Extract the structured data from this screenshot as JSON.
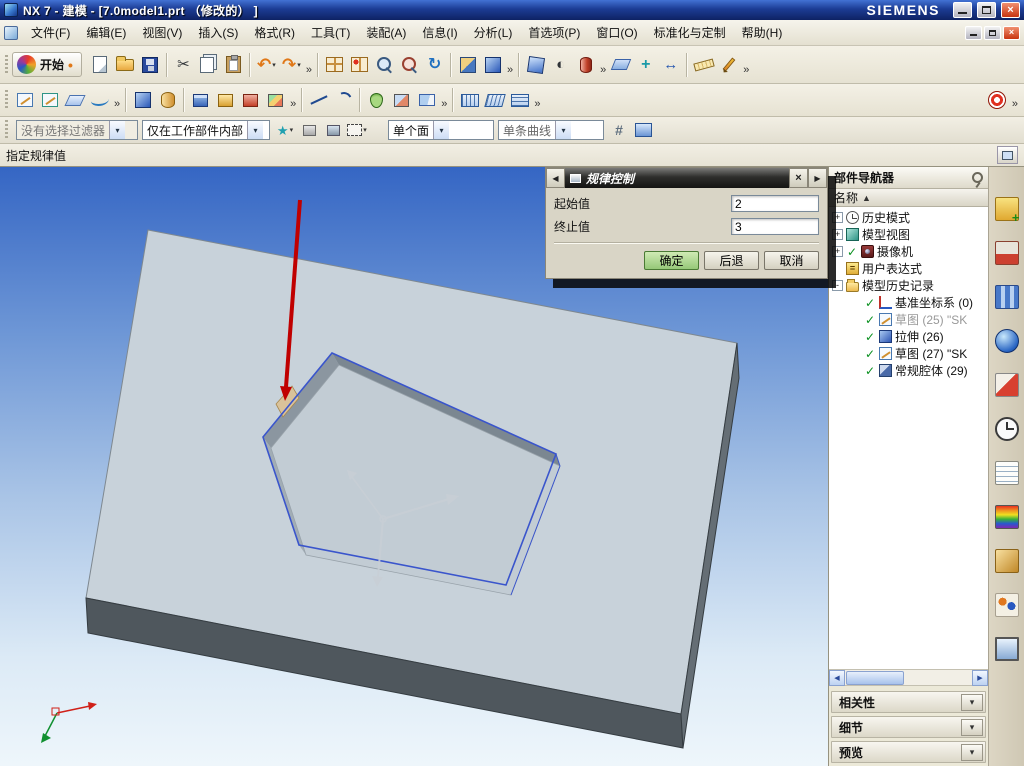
{
  "glyphs": {
    "overflow": "»",
    "dropdown": "▾",
    "check": "✓",
    "sort_asc": "▲",
    "back": "◀",
    "forward": "▶",
    "close": "×",
    "section_chevron": "▾",
    "scroll_left": "◀",
    "scroll_right": "▶",
    "bullet": "•"
  },
  "window": {
    "title": "NX 7 - 建模 - [7.0model1.prt （修改的） ]",
    "brand": "SIEMENS"
  },
  "menubar": {
    "items": [
      {
        "label": "文件(F)",
        "name": "menu-file"
      },
      {
        "label": "编辑(E)",
        "name": "menu-edit"
      },
      {
        "label": "视图(V)",
        "name": "menu-view"
      },
      {
        "label": "插入(S)",
        "name": "menu-insert"
      },
      {
        "label": "格式(R)",
        "name": "menu-format"
      },
      {
        "label": "工具(T)",
        "name": "menu-tools"
      },
      {
        "label": "装配(A)",
        "name": "menu-assemblies"
      },
      {
        "label": "信息(I)",
        "name": "menu-information"
      },
      {
        "label": "分析(L)",
        "name": "menu-analysis"
      },
      {
        "label": "首选项(P)",
        "name": "menu-preferences"
      },
      {
        "label": "窗口(O)",
        "name": "menu-window"
      },
      {
        "label": "标准化与定制",
        "name": "menu-customize"
      },
      {
        "label": "帮助(H)",
        "name": "menu-help"
      }
    ]
  },
  "toolbar_main": {
    "start_label": "开始",
    "icons": [
      {
        "name": "new-file-icon",
        "cls": "i-page"
      },
      {
        "name": "open-icon",
        "cls": "i-folder"
      },
      {
        "name": "save-icon",
        "cls": "i-floppy"
      },
      {
        "type": "sep"
      },
      {
        "name": "cut-icon",
        "cls": "g-dark",
        "glyph": "✂"
      },
      {
        "name": "copy-icon",
        "cls": "i-copy"
      },
      {
        "name": "paste-icon",
        "cls": "i-paste"
      },
      {
        "type": "sep"
      },
      {
        "name": "undo-icon",
        "cls": "g-orange",
        "glyph": "↶",
        "drop": true
      },
      {
        "name": "redo-icon",
        "cls": "g-orange",
        "glyph": "↷",
        "drop": true
      },
      {
        "type": "more"
      },
      {
        "type": "sep"
      },
      {
        "name": "display-part-icon",
        "cls": "i-grid-a"
      },
      {
        "name": "window-layout-icon",
        "cls": "i-grid-b"
      },
      {
        "name": "zoom-window-icon",
        "cls": "i-mag"
      },
      {
        "name": "zoom-fit-icon",
        "cls": "i-mag2"
      },
      {
        "name": "refresh-view-icon",
        "cls": "g-blue",
        "glyph": "↻"
      },
      {
        "type": "sep"
      },
      {
        "name": "section-view-icon",
        "cls": "i-cube-cut"
      },
      {
        "name": "shaded-display-icon",
        "cls": "i-cube-blue"
      },
      {
        "type": "more"
      },
      {
        "type": "sep"
      },
      {
        "name": "orient-view-icon",
        "cls": "i-cube-blue2"
      },
      {
        "name": "rendering-style-icon",
        "cls": "g-dark",
        "glyph": "◐"
      },
      {
        "name": "true-shading-icon",
        "cls": "i-cyl-red"
      },
      {
        "type": "more"
      },
      {
        "type": "gap"
      },
      {
        "name": "datum-display-icon",
        "cls": "i-datum"
      },
      {
        "name": "constraint-display-icon",
        "cls": "i-snap",
        "glyph": "+"
      },
      {
        "name": "move-object-icon",
        "cls": "i-move",
        "glyph": "↔"
      },
      {
        "type": "sep"
      },
      {
        "name": "measure-distance-icon",
        "cls": "i-ruler"
      },
      {
        "name": "edit-object-display-icon",
        "cls": "i-pencil"
      },
      {
        "type": "more"
      }
    ]
  },
  "toolbar_feature": {
    "icons": [
      {
        "name": "sketch-icon",
        "cls": "i-sketch"
      },
      {
        "name": "sketch-in-task-icon",
        "cls": "i-sketch2"
      },
      {
        "name": "datum-plane-icon",
        "cls": "i-plane"
      },
      {
        "name": "curve-icon",
        "cls": "i-spline"
      },
      {
        "type": "more"
      },
      {
        "type": "sep"
      },
      {
        "name": "extrude-icon",
        "cls": "i-cube-blue"
      },
      {
        "name": "revolve-icon",
        "cls": "i-rev"
      },
      {
        "type": "sep"
      },
      {
        "name": "block-icon",
        "cls": "i-blk-blue"
      },
      {
        "name": "cylinder-icon",
        "cls": "i-blk-gold"
      },
      {
        "name": "boss-icon",
        "cls": "i-blk-red"
      },
      {
        "name": "cavity-icon",
        "cls": "i-blk-multi"
      },
      {
        "type": "more"
      },
      {
        "type": "sep"
      },
      {
        "name": "line-icon",
        "cls": "i-line"
      },
      {
        "name": "arc-icon",
        "cls": "i-arc"
      },
      {
        "type": "sep"
      },
      {
        "name": "unite-icon",
        "cls": "i-pear"
      },
      {
        "name": "subtract-icon",
        "cls": "i-bool-sub"
      },
      {
        "name": "trim-body-icon",
        "cls": "i-trim"
      },
      {
        "type": "more"
      },
      {
        "type": "sep"
      },
      {
        "name": "through-curves-icon",
        "cls": "i-mesh"
      },
      {
        "name": "swept-icon",
        "cls": "i-mesh2"
      },
      {
        "name": "n-sided-surface-icon",
        "cls": "i-mesh3"
      },
      {
        "type": "more"
      },
      {
        "type": "gap"
      },
      {
        "name": "repeat-command-icon",
        "cls": "i-target"
      },
      {
        "type": "more"
      }
    ]
  },
  "selection_bar": {
    "filter": "没有选择过滤器",
    "scope": "仅在工作部件内部",
    "face_rule": "单个面",
    "curve_rule": "单条曲线",
    "left_icons": [
      {
        "name": "snap-point-icon",
        "cls": "i-star",
        "glyph": "★",
        "drop": true
      },
      {
        "name": "selection-priority-icon",
        "cls": "i-blk-gray"
      },
      {
        "name": "highlight-icon",
        "cls": "i-blk-gray2"
      },
      {
        "name": "marquee-select-icon",
        "cls": "i-marquee",
        "drop": true
      }
    ],
    "right_icons": [
      {
        "name": "grid-snap-icon",
        "cls": "i-hash",
        "glyph": "#"
      },
      {
        "name": "dialog-window-icon",
        "cls": "i-win"
      }
    ]
  },
  "prompt": {
    "text": "指定规律值"
  },
  "dialog": {
    "title": "规律控制",
    "fields": [
      {
        "label": "起始值",
        "value": "2"
      },
      {
        "label": "终止值",
        "value": "3"
      }
    ],
    "buttons": {
      "ok": "确定",
      "back": "后退",
      "cancel": "取消"
    }
  },
  "navigator": {
    "title": "部件导航器",
    "name_column": "名称",
    "tree": [
      {
        "name": "tree-item-history-mode",
        "label": "历史模式",
        "expand": "+",
        "icon": "clock"
      },
      {
        "name": "tree-item-model-views",
        "label": "模型视图",
        "expand": "+",
        "icon": "views"
      },
      {
        "name": "tree-item-cameras",
        "label": "摄像机",
        "expand": "+",
        "check": true,
        "icon": "camera"
      },
      {
        "name": "tree-item-user-expressions",
        "label": "用户表达式",
        "icon": "expr"
      },
      {
        "name": "tree-item-model-history",
        "label": "模型历史记录",
        "expand": "-",
        "icon": "folder"
      },
      {
        "name": "tree-item-datum-csys",
        "label": "基准坐标系 (0)",
        "check": true,
        "icon": "csys",
        "indent": true
      },
      {
        "name": "tree-item-sketch-25",
        "label": "草图 (25) \"SK",
        "check": true,
        "icon": "sketch",
        "indent": true,
        "gray": true
      },
      {
        "name": "tree-item-extrude-26",
        "label": "拉伸 (26)",
        "check": true,
        "icon": "extrude",
        "indent": true
      },
      {
        "name": "tree-item-sketch-27",
        "label": "草图 (27) \"SK",
        "check": true,
        "icon": "sketch",
        "indent": true
      },
      {
        "name": "tree-item-general-pocket-29",
        "label": "常规腔体 (29)",
        "check": true,
        "icon": "pocket",
        "indent": true
      }
    ],
    "sections": [
      {
        "name": "section-dependencies",
        "label": "相关性"
      },
      {
        "name": "section-details",
        "label": "细节"
      },
      {
        "name": "section-preview",
        "label": "预览"
      }
    ]
  },
  "right_strip": {
    "icons": [
      {
        "name": "assembly-navigator-icon",
        "cls": "rs-1"
      },
      {
        "name": "constraint-navigator-icon",
        "cls": "rs-2"
      },
      {
        "name": "part-navigator-icon",
        "cls": "rs-3"
      },
      {
        "name": "internet-explorer-icon",
        "cls": "rs-4"
      },
      {
        "name": "hd3d-tool-icon",
        "cls": "rs-5"
      },
      {
        "name": "history-icon",
        "cls": "rs-6"
      },
      {
        "name": "information-icon",
        "cls": "rs-7"
      },
      {
        "name": "palette-icon",
        "cls": "rs-8"
      },
      {
        "name": "materials-icon",
        "cls": "rs-9"
      },
      {
        "name": "roles-icon",
        "cls": "rs-10"
      },
      {
        "name": "touch-icon",
        "cls": "rs-11"
      }
    ]
  }
}
